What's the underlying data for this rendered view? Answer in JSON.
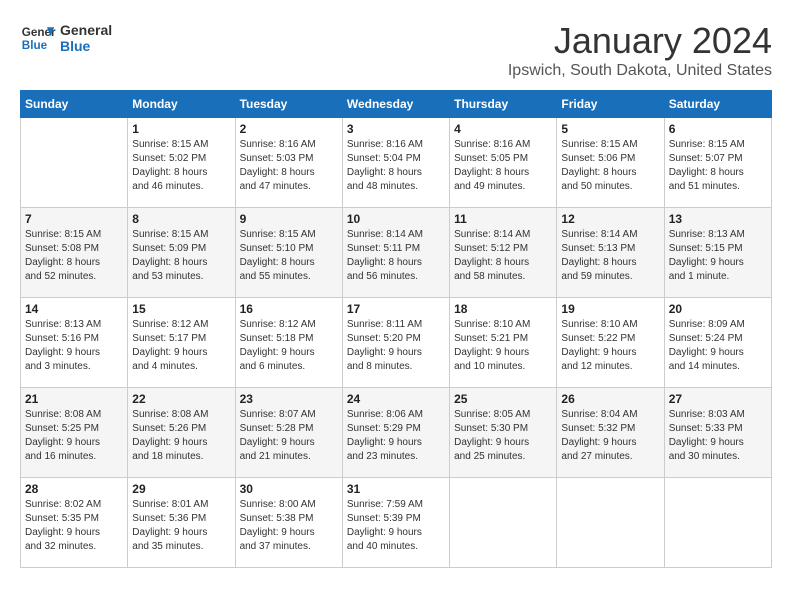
{
  "logo": {
    "line1": "General",
    "line2": "Blue"
  },
  "title": "January 2024",
  "subtitle": "Ipswich, South Dakota, United States",
  "days_of_week": [
    "Sunday",
    "Monday",
    "Tuesday",
    "Wednesday",
    "Thursday",
    "Friday",
    "Saturday"
  ],
  "weeks": [
    [
      {
        "day": "",
        "info": ""
      },
      {
        "day": "1",
        "info": "Sunrise: 8:15 AM\nSunset: 5:02 PM\nDaylight: 8 hours\nand 46 minutes."
      },
      {
        "day": "2",
        "info": "Sunrise: 8:16 AM\nSunset: 5:03 PM\nDaylight: 8 hours\nand 47 minutes."
      },
      {
        "day": "3",
        "info": "Sunrise: 8:16 AM\nSunset: 5:04 PM\nDaylight: 8 hours\nand 48 minutes."
      },
      {
        "day": "4",
        "info": "Sunrise: 8:16 AM\nSunset: 5:05 PM\nDaylight: 8 hours\nand 49 minutes."
      },
      {
        "day": "5",
        "info": "Sunrise: 8:15 AM\nSunset: 5:06 PM\nDaylight: 8 hours\nand 50 minutes."
      },
      {
        "day": "6",
        "info": "Sunrise: 8:15 AM\nSunset: 5:07 PM\nDaylight: 8 hours\nand 51 minutes."
      }
    ],
    [
      {
        "day": "7",
        "info": "Sunrise: 8:15 AM\nSunset: 5:08 PM\nDaylight: 8 hours\nand 52 minutes."
      },
      {
        "day": "8",
        "info": "Sunrise: 8:15 AM\nSunset: 5:09 PM\nDaylight: 8 hours\nand 53 minutes."
      },
      {
        "day": "9",
        "info": "Sunrise: 8:15 AM\nSunset: 5:10 PM\nDaylight: 8 hours\nand 55 minutes."
      },
      {
        "day": "10",
        "info": "Sunrise: 8:14 AM\nSunset: 5:11 PM\nDaylight: 8 hours\nand 56 minutes."
      },
      {
        "day": "11",
        "info": "Sunrise: 8:14 AM\nSunset: 5:12 PM\nDaylight: 8 hours\nand 58 minutes."
      },
      {
        "day": "12",
        "info": "Sunrise: 8:14 AM\nSunset: 5:13 PM\nDaylight: 8 hours\nand 59 minutes."
      },
      {
        "day": "13",
        "info": "Sunrise: 8:13 AM\nSunset: 5:15 PM\nDaylight: 9 hours\nand 1 minute."
      }
    ],
    [
      {
        "day": "14",
        "info": "Sunrise: 8:13 AM\nSunset: 5:16 PM\nDaylight: 9 hours\nand 3 minutes."
      },
      {
        "day": "15",
        "info": "Sunrise: 8:12 AM\nSunset: 5:17 PM\nDaylight: 9 hours\nand 4 minutes."
      },
      {
        "day": "16",
        "info": "Sunrise: 8:12 AM\nSunset: 5:18 PM\nDaylight: 9 hours\nand 6 minutes."
      },
      {
        "day": "17",
        "info": "Sunrise: 8:11 AM\nSunset: 5:20 PM\nDaylight: 9 hours\nand 8 minutes."
      },
      {
        "day": "18",
        "info": "Sunrise: 8:10 AM\nSunset: 5:21 PM\nDaylight: 9 hours\nand 10 minutes."
      },
      {
        "day": "19",
        "info": "Sunrise: 8:10 AM\nSunset: 5:22 PM\nDaylight: 9 hours\nand 12 minutes."
      },
      {
        "day": "20",
        "info": "Sunrise: 8:09 AM\nSunset: 5:24 PM\nDaylight: 9 hours\nand 14 minutes."
      }
    ],
    [
      {
        "day": "21",
        "info": "Sunrise: 8:08 AM\nSunset: 5:25 PM\nDaylight: 9 hours\nand 16 minutes."
      },
      {
        "day": "22",
        "info": "Sunrise: 8:08 AM\nSunset: 5:26 PM\nDaylight: 9 hours\nand 18 minutes."
      },
      {
        "day": "23",
        "info": "Sunrise: 8:07 AM\nSunset: 5:28 PM\nDaylight: 9 hours\nand 21 minutes."
      },
      {
        "day": "24",
        "info": "Sunrise: 8:06 AM\nSunset: 5:29 PM\nDaylight: 9 hours\nand 23 minutes."
      },
      {
        "day": "25",
        "info": "Sunrise: 8:05 AM\nSunset: 5:30 PM\nDaylight: 9 hours\nand 25 minutes."
      },
      {
        "day": "26",
        "info": "Sunrise: 8:04 AM\nSunset: 5:32 PM\nDaylight: 9 hours\nand 27 minutes."
      },
      {
        "day": "27",
        "info": "Sunrise: 8:03 AM\nSunset: 5:33 PM\nDaylight: 9 hours\nand 30 minutes."
      }
    ],
    [
      {
        "day": "28",
        "info": "Sunrise: 8:02 AM\nSunset: 5:35 PM\nDaylight: 9 hours\nand 32 minutes."
      },
      {
        "day": "29",
        "info": "Sunrise: 8:01 AM\nSunset: 5:36 PM\nDaylight: 9 hours\nand 35 minutes."
      },
      {
        "day": "30",
        "info": "Sunrise: 8:00 AM\nSunset: 5:38 PM\nDaylight: 9 hours\nand 37 minutes."
      },
      {
        "day": "31",
        "info": "Sunrise: 7:59 AM\nSunset: 5:39 PM\nDaylight: 9 hours\nand 40 minutes."
      },
      {
        "day": "",
        "info": ""
      },
      {
        "day": "",
        "info": ""
      },
      {
        "day": "",
        "info": ""
      }
    ]
  ]
}
